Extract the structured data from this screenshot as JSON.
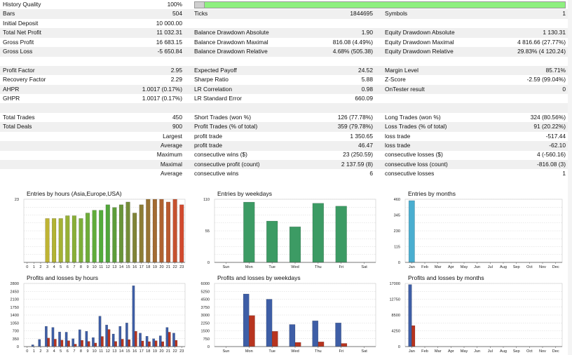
{
  "report": {
    "history_quality": {
      "label": "History Quality",
      "value": "100%",
      "fraction": 1.0
    },
    "rows": [
      {
        "alt": true,
        "cells": [
          [
            "Bars",
            "504"
          ],
          [
            "Ticks",
            "1844695"
          ],
          [
            "Symbols",
            "1"
          ]
        ]
      },
      {
        "alt": false,
        "cells": [
          [
            "Initial Deposit",
            "10 000.00"
          ],
          [
            "",
            ""
          ],
          [
            "",
            ""
          ]
        ]
      },
      {
        "alt": true,
        "cells": [
          [
            "Total Net Profit",
            "11 032.31"
          ],
          [
            "Balance Drawdown Absolute",
            "1.90"
          ],
          [
            "Equity Drawdown Absolute",
            "1 130.31"
          ]
        ]
      },
      {
        "alt": false,
        "cells": [
          [
            "Gross Profit",
            "16 683.15"
          ],
          [
            "Balance Drawdown Maximal",
            "816.08 (4.49%)"
          ],
          [
            "Equity Drawdown Maximal",
            "4 816.66 (27.77%)"
          ]
        ]
      },
      {
        "alt": true,
        "cells": [
          [
            "Gross Loss",
            "-5 650.84"
          ],
          [
            "Balance Drawdown Relative",
            "4.68% (505.38)"
          ],
          [
            "Equity Drawdown Relative",
            "29.83% (4 120.24)"
          ]
        ]
      },
      {
        "alt": false,
        "cells": [
          [
            "",
            ""
          ],
          [
            "",
            ""
          ],
          [
            "",
            ""
          ]
        ]
      },
      {
        "alt": true,
        "cells": [
          [
            "Profit Factor",
            "2.95"
          ],
          [
            "Expected Payoff",
            "24.52"
          ],
          [
            "Margin Level",
            "85.71%"
          ]
        ]
      },
      {
        "alt": false,
        "cells": [
          [
            "Recovery Factor",
            "2.29"
          ],
          [
            "Sharpe Ratio",
            "5.88"
          ],
          [
            "Z-Score",
            "-2.59 (99.04%)"
          ]
        ]
      },
      {
        "alt": true,
        "cells": [
          [
            "AHPR",
            "1.0017 (0.17%)"
          ],
          [
            "LR Correlation",
            "0.98"
          ],
          [
            "OnTester result",
            "0"
          ]
        ]
      },
      {
        "alt": false,
        "cells": [
          [
            "GHPR",
            "1.0017 (0.17%)"
          ],
          [
            "LR Standard Error",
            "660.09"
          ],
          [
            "",
            ""
          ]
        ]
      },
      {
        "alt": true,
        "cells": [
          [
            "",
            ""
          ],
          [
            "",
            ""
          ],
          [
            "",
            ""
          ]
        ]
      },
      {
        "alt": false,
        "cells": [
          [
            "Total Trades",
            "450"
          ],
          [
            "Short Trades (won %)",
            "126 (77.78%)"
          ],
          [
            "Long Trades (won %)",
            "324 (80.56%)"
          ]
        ]
      },
      {
        "alt": true,
        "cells": [
          [
            "Total Deals",
            "900"
          ],
          [
            "Profit Trades (% of total)",
            "359 (79.78%)"
          ],
          [
            "Loss Trades (% of total)",
            "91 (20.22%)"
          ]
        ]
      },
      {
        "alt": false,
        "cells": [
          [
            "",
            "Largest"
          ],
          [
            "profit trade",
            "1 350.65"
          ],
          [
            "loss trade",
            "-517.44"
          ]
        ]
      },
      {
        "alt": true,
        "cells": [
          [
            "",
            "Average"
          ],
          [
            "profit trade",
            "46.47"
          ],
          [
            "loss trade",
            "-62.10"
          ]
        ]
      },
      {
        "alt": false,
        "cells": [
          [
            "",
            "Maximum"
          ],
          [
            "consecutive wins ($)",
            "23 (250.59)"
          ],
          [
            "consecutive losses ($)",
            "4 (-560.16)"
          ]
        ]
      },
      {
        "alt": true,
        "cells": [
          [
            "",
            "Maximal"
          ],
          [
            "consecutive profit (count)",
            "2 137.59 (8)"
          ],
          [
            "consecutive loss (count)",
            "-816.08 (3)"
          ]
        ]
      },
      {
        "alt": false,
        "cells": [
          [
            "",
            "Average"
          ],
          [
            "consecutive wins",
            "6"
          ],
          [
            "consecutive losses",
            "1"
          ]
        ]
      }
    ]
  },
  "colors": {
    "grid": "#d6d6d6",
    "axis": "#555555",
    "profit_blue": "#3e5ea6",
    "loss_red": "#b8341f",
    "weekday_green": "#3c9b64",
    "month_cyan": "#4aaed0"
  },
  "chart_data": [
    {
      "id": "entries-by-hours",
      "type": "bar",
      "title": "Entries by hours (Asia,Europe,USA)",
      "categories": [
        "0",
        "1",
        "2",
        "3",
        "4",
        "5",
        "6",
        "7",
        "8",
        "9",
        "10",
        "11",
        "12",
        "13",
        "14",
        "15",
        "16",
        "17",
        "18",
        "19",
        "20",
        "21",
        "22",
        "23"
      ],
      "ylim": [
        0,
        23
      ],
      "yticks": [
        "23"
      ],
      "series": [
        {
          "values": [
            0,
            0,
            0,
            16,
            16,
            16,
            17,
            17,
            16,
            18,
            19,
            19,
            21,
            20,
            21,
            22,
            18,
            21,
            23,
            23,
            23,
            22,
            23,
            21
          ]
        }
      ]
    },
    {
      "id": "entries-by-weekdays",
      "type": "bar",
      "title": "Entries by weekdays",
      "categories": [
        "Sun",
        "Mon",
        "Tue",
        "Wed",
        "Thu",
        "Fri",
        "Sat"
      ],
      "ylim": [
        0,
        110
      ],
      "yticks": [
        "0",
        "55",
        "110"
      ],
      "series": [
        {
          "values": [
            0,
            105,
            72,
            62,
            103,
            98,
            0
          ]
        }
      ]
    },
    {
      "id": "entries-by-months",
      "type": "bar",
      "title": "Entries by months",
      "categories": [
        "Jan",
        "Feb",
        "Mar",
        "Apr",
        "May",
        "Jun",
        "Jul",
        "Aug",
        "Sep",
        "Oct",
        "Nov",
        "Dec"
      ],
      "ylim": [
        0,
        460
      ],
      "yticks": [
        "0",
        "115",
        "230",
        "345",
        "460"
      ],
      "series": [
        {
          "values": [
            450,
            0,
            0,
            0,
            0,
            0,
            0,
            0,
            0,
            0,
            0,
            0
          ]
        }
      ]
    },
    {
      "id": "profits-losses-by-hours",
      "type": "bar",
      "title": "Profits and losses by hours",
      "categories": [
        "0",
        "1",
        "2",
        "3",
        "4",
        "5",
        "6",
        "7",
        "8",
        "9",
        "10",
        "11",
        "12",
        "13",
        "14",
        "15",
        "16",
        "17",
        "18",
        "19",
        "20",
        "21",
        "22",
        "23"
      ],
      "ylim": [
        0,
        2800
      ],
      "yticks": [
        "0",
        "350",
        "700",
        "1050",
        "1400",
        "1750",
        "2100",
        "2450",
        "2800"
      ],
      "series": [
        {
          "values": [
            0,
            80,
            320,
            900,
            850,
            650,
            640,
            350,
            750,
            680,
            400,
            1350,
            960,
            560,
            900,
            1050,
            2700,
            600,
            460,
            350,
            480,
            850,
            600,
            0
          ]
        },
        {
          "values": [
            0,
            0,
            0,
            380,
            330,
            290,
            260,
            110,
            280,
            230,
            160,
            450,
            760,
            230,
            330,
            310,
            680,
            250,
            220,
            260,
            220,
            640,
            280,
            0
          ]
        }
      ]
    },
    {
      "id": "profits-losses-by-weekdays",
      "type": "bar",
      "title": "Profits and losses by weekdays",
      "categories": [
        "Sun",
        "Mon",
        "Tue",
        "Wed",
        "Thu",
        "Fri",
        "Sat"
      ],
      "ylim": [
        0,
        6000
      ],
      "yticks": [
        "0",
        "750",
        "1500",
        "2250",
        "3000",
        "3750",
        "4500",
        "5250",
        "6000"
      ],
      "series": [
        {
          "values": [
            0,
            5000,
            4500,
            2100,
            2450,
            2250,
            0
          ]
        },
        {
          "values": [
            0,
            2950,
            1450,
            400,
            450,
            300,
            0
          ]
        }
      ]
    },
    {
      "id": "profits-losses-by-months",
      "type": "bar",
      "title": "Profits and losses by months",
      "categories": [
        "Jan",
        "Feb",
        "Mar",
        "Apr",
        "May",
        "Jun",
        "Jul",
        "Aug",
        "Sep",
        "Oct",
        "Nov",
        "Dec"
      ],
      "ylim": [
        0,
        17000
      ],
      "yticks": [
        "0",
        "4250",
        "8500",
        "12750",
        "17000"
      ],
      "series": [
        {
          "values": [
            16700,
            0,
            0,
            0,
            0,
            0,
            0,
            0,
            0,
            0,
            0,
            0
          ]
        },
        {
          "values": [
            5650,
            0,
            0,
            0,
            0,
            0,
            0,
            0,
            0,
            0,
            0,
            0
          ]
        }
      ]
    }
  ]
}
